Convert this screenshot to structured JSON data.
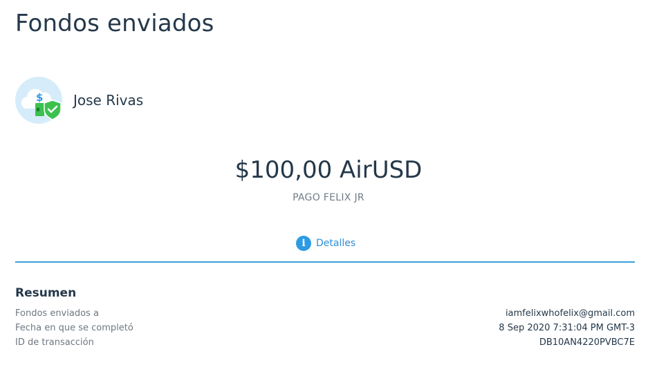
{
  "page": {
    "title": "Fondos enviados"
  },
  "recipient": {
    "name": "Jose Rivas",
    "avatar_icon": "cloud-money-shield-icon",
    "avatar_bg": "#d6ecfa",
    "shield_color": "#3cc14f"
  },
  "transfer": {
    "amount": "$100,00 AirUSD",
    "memo": "PAGO FELIX JR"
  },
  "tabs": [
    {
      "label": "Detalles",
      "icon": "info-icon",
      "active": true
    }
  ],
  "summary": {
    "title": "Resumen",
    "rows": [
      {
        "label": "Fondos enviados a",
        "value": "iamfelixwhofelix@gmail.com"
      },
      {
        "label": "Fecha en que se completó",
        "value": "8 Sep 2020 7:31:04 PM GMT-3"
      },
      {
        "label": "ID de transacción",
        "value": "DB10AN4220PVBC7E"
      }
    ]
  },
  "colors": {
    "accent": "#2d9be3",
    "divider": "#3aa1d8",
    "text_primary": "#24384a",
    "text_secondary": "#6e7781"
  }
}
